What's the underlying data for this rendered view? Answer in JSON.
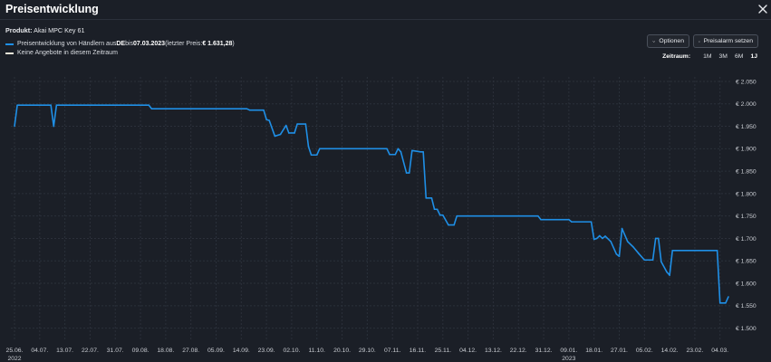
{
  "window": {
    "title": "Preisentwicklung",
    "close_icon": "close-icon"
  },
  "product": {
    "label": "Produkt:",
    "name": "Akai MPC Key 61"
  },
  "legend": [
    {
      "pre": "Preisentwicklung von Händlern aus ",
      "country": "DE",
      "mid": " bis ",
      "date": "07.03.2023",
      "post1": " (letzter Preis: ",
      "price": "€ 1.631,28",
      "post2": ")",
      "color": "#1f8fe6"
    },
    {
      "text": "Keine Angebote in diesem Zeitraum",
      "color": "#e8e4d6"
    }
  ],
  "buttons": {
    "options": {
      "label": "Optionen",
      "icon": "chevron-down-icon"
    },
    "alarm": {
      "label": "Preisalarm setzen",
      "icon": "bell-icon"
    }
  },
  "zeitraum": {
    "label": "Zeitraum:",
    "options": [
      "1M",
      "3M",
      "6M",
      "1J"
    ],
    "active": "1J"
  },
  "colors": {
    "background": "#1b1f27",
    "grid": "#2b303a",
    "line": "#1f8fe6"
  },
  "chart_data": {
    "type": "line",
    "title": "",
    "ylabel": "",
    "ylim": [
      1475,
      2060
    ],
    "y_ticks": [
      1500,
      1550,
      1600,
      1650,
      1700,
      1750,
      1800,
      1850,
      1900,
      1950,
      2000,
      2050
    ],
    "y_tick_labels": [
      "€ 1.500",
      "€ 1.550",
      "€ 1.600",
      "€ 1.650",
      "€ 1.700",
      "€ 1.750",
      "€ 1.800",
      "€ 1.850",
      "€ 1.900",
      "€ 1.950",
      "€ 2.000",
      "€ 2.050"
    ],
    "x_range": [
      "2022-06-25",
      "2023-03-07"
    ],
    "x_ticks": [
      "2022-06-25",
      "2022-07-04",
      "2022-07-13",
      "2022-07-22",
      "2022-07-31",
      "2022-08-09",
      "2022-08-18",
      "2022-08-27",
      "2022-09-05",
      "2022-09-14",
      "2022-09-23",
      "2022-10-02",
      "2022-10-11",
      "2022-10-20",
      "2022-10-29",
      "2022-11-07",
      "2022-11-16",
      "2022-11-25",
      "2022-12-04",
      "2022-12-13",
      "2022-12-22",
      "2022-12-31",
      "2023-01-09",
      "2023-01-18",
      "2023-01-27",
      "2023-02-05",
      "2023-02-14",
      "2023-02-23",
      "2023-03-04"
    ],
    "x_tick_labels": [
      "25.06.",
      "04.07.",
      "13.07.",
      "22.07.",
      "31.07.",
      "09.08.",
      "18.08.",
      "27.08.",
      "05.09.",
      "14.09.",
      "23.09.",
      "02.10.",
      "11.10.",
      "20.10.",
      "29.10.",
      "07.11.",
      "16.11.",
      "25.11.",
      "04.12.",
      "13.12.",
      "22.12.",
      "31.12.",
      "09.01.",
      "18.01.",
      "27.01.",
      "05.02.",
      "14.02.",
      "23.02.",
      "04.03."
    ],
    "x_year_labels": [
      {
        "date": "2022-06-25",
        "label": "2022"
      },
      {
        "date": "2023-01-09",
        "label": "2023"
      }
    ],
    "series": [
      {
        "points": [
          [
            "2022-06-25",
            1950
          ],
          [
            "2022-06-26",
            1997
          ],
          [
            "2022-07-08",
            1997
          ],
          [
            "2022-07-09",
            1950
          ],
          [
            "2022-07-10",
            1997
          ],
          [
            "2022-08-12",
            1997
          ],
          [
            "2022-08-13",
            1989
          ],
          [
            "2022-09-16",
            1989
          ],
          [
            "2022-09-17",
            1986
          ],
          [
            "2022-09-22",
            1986
          ],
          [
            "2022-09-23",
            1965
          ],
          [
            "2022-09-24",
            1963
          ],
          [
            "2022-09-26",
            1928
          ],
          [
            "2022-09-28",
            1932
          ],
          [
            "2022-09-30",
            1952
          ],
          [
            "2022-10-01",
            1935
          ],
          [
            "2022-10-03",
            1935
          ],
          [
            "2022-10-04",
            1955
          ],
          [
            "2022-10-07",
            1955
          ],
          [
            "2022-10-08",
            1905
          ],
          [
            "2022-10-09",
            1886
          ],
          [
            "2022-10-11",
            1886
          ],
          [
            "2022-10-12",
            1900
          ],
          [
            "2022-11-05",
            1900
          ],
          [
            "2022-11-06",
            1887
          ],
          [
            "2022-11-08",
            1887
          ],
          [
            "2022-11-09",
            1900
          ],
          [
            "2022-11-10",
            1893
          ],
          [
            "2022-11-12",
            1846
          ],
          [
            "2022-11-13",
            1846
          ],
          [
            "2022-11-14",
            1896
          ],
          [
            "2022-11-17",
            1893
          ],
          [
            "2022-11-18",
            1893
          ],
          [
            "2022-11-19",
            1790
          ],
          [
            "2022-11-21",
            1790
          ],
          [
            "2022-11-22",
            1765
          ],
          [
            "2022-11-23",
            1765
          ],
          [
            "2022-11-24",
            1752
          ],
          [
            "2022-11-25",
            1752
          ],
          [
            "2022-11-27",
            1730
          ],
          [
            "2022-11-29",
            1730
          ],
          [
            "2022-11-30",
            1750
          ],
          [
            "2022-12-29",
            1750
          ],
          [
            "2022-12-30",
            1742
          ],
          [
            "2023-01-09",
            1742
          ],
          [
            "2023-01-10",
            1737
          ],
          [
            "2023-01-17",
            1737
          ],
          [
            "2023-01-18",
            1698
          ],
          [
            "2023-01-19",
            1700
          ],
          [
            "2023-01-20",
            1706
          ],
          [
            "2023-01-21",
            1700
          ],
          [
            "2023-01-22",
            1705
          ],
          [
            "2023-01-24",
            1693
          ],
          [
            "2023-01-26",
            1665
          ],
          [
            "2023-01-27",
            1660
          ],
          [
            "2023-01-28",
            1722
          ],
          [
            "2023-01-30",
            1693
          ],
          [
            "2023-02-01",
            1681
          ],
          [
            "2023-02-03",
            1666
          ],
          [
            "2023-02-05",
            1652
          ],
          [
            "2023-02-08",
            1652
          ],
          [
            "2023-02-09",
            1700
          ],
          [
            "2023-02-10",
            1700
          ],
          [
            "2023-02-11",
            1648
          ],
          [
            "2023-02-13",
            1625
          ],
          [
            "2023-02-14",
            1618
          ],
          [
            "2023-02-15",
            1673
          ],
          [
            "2023-03-03",
            1673
          ],
          [
            "2023-03-04",
            1556
          ],
          [
            "2023-03-06",
            1556
          ],
          [
            "2023-03-07",
            1570
          ]
        ]
      }
    ],
    "grid": true
  }
}
